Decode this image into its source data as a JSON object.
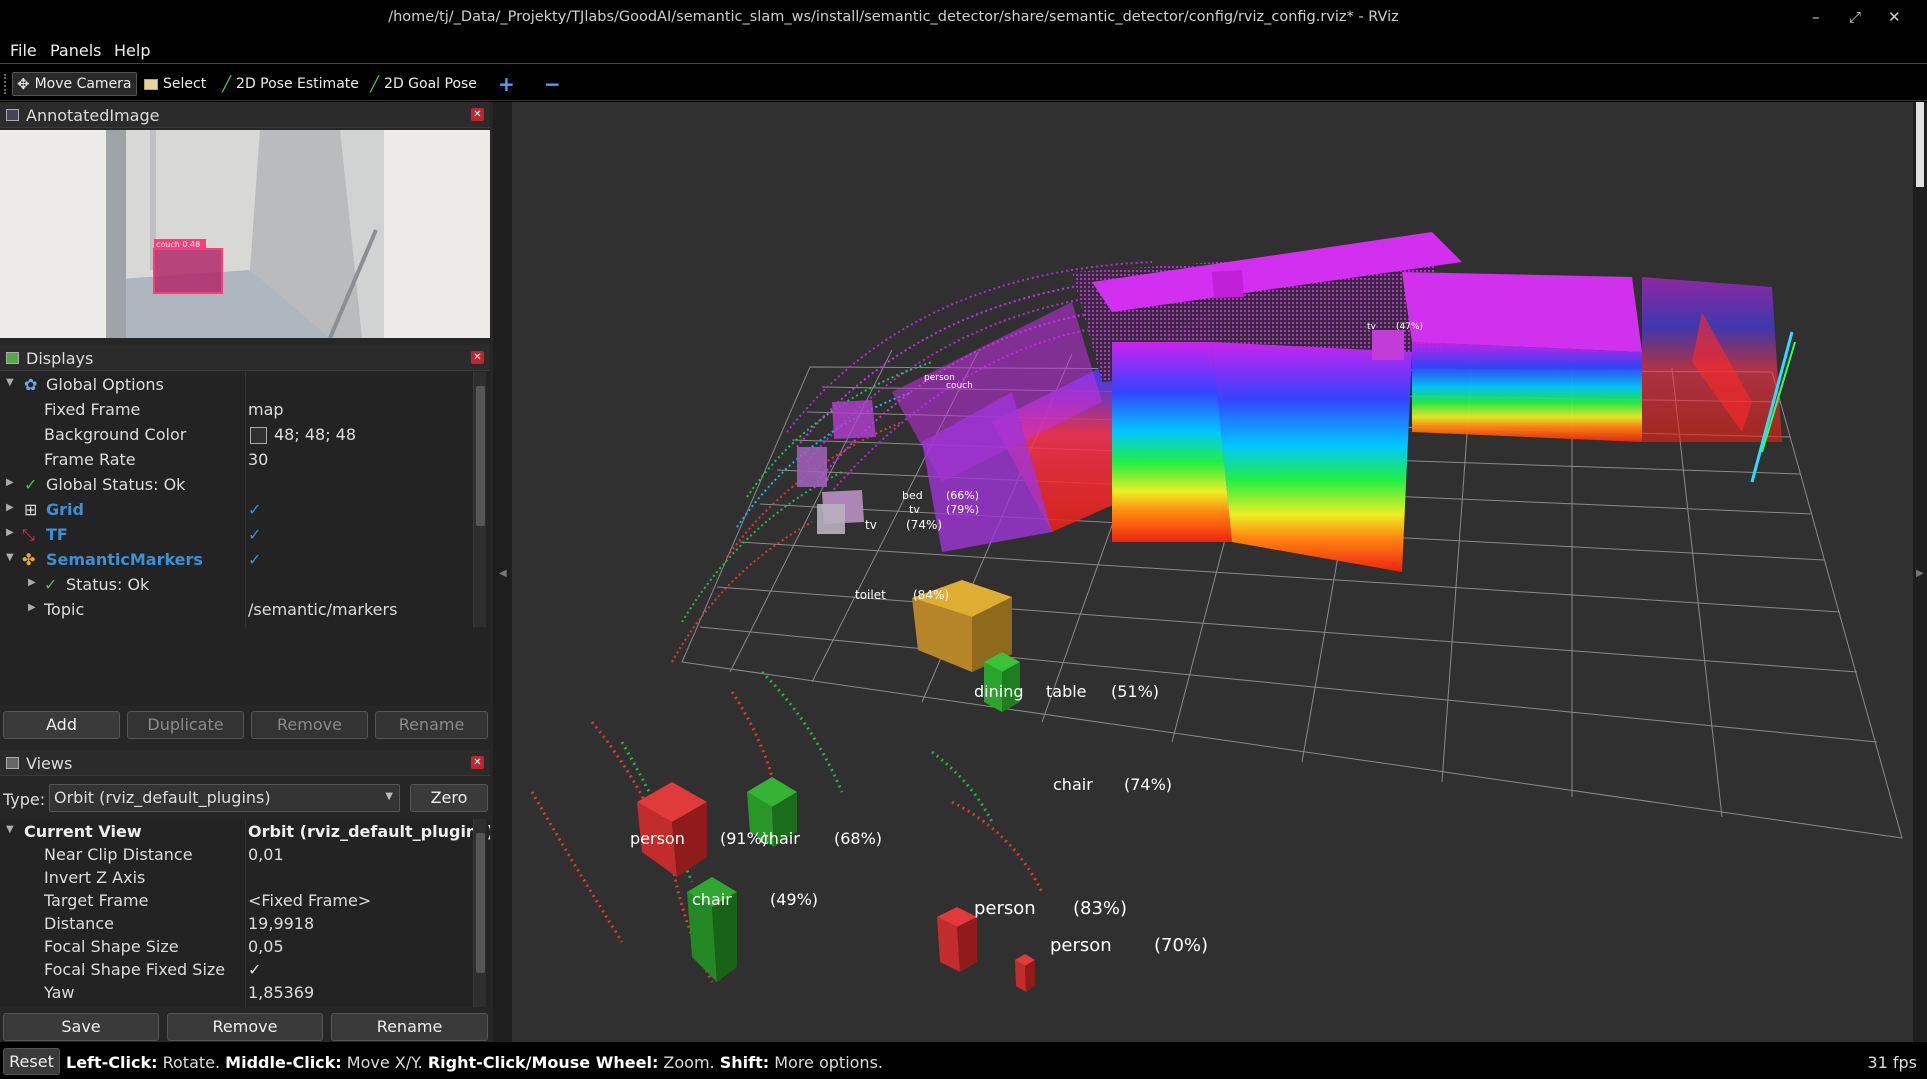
{
  "window": {
    "title": "/home/tj/_Data/_Projekty/TJlabs/GoodAI/semantic_slam_ws/install/semantic_detector/share/semantic_detector/config/rviz_config.rviz* - RViz",
    "minimize": "–",
    "maximize": "⤢",
    "close": "✕"
  },
  "menu": {
    "file": "File",
    "panels": "Panels",
    "help": "Help"
  },
  "toolbar": {
    "move_camera": "Move Camera",
    "select": "Select",
    "pose_estimate": "2D Pose Estimate",
    "goal_pose": "2D Goal Pose",
    "add": "+",
    "remove": "−"
  },
  "annotated_image": {
    "title": "AnnotatedImage",
    "detection_label": "couch 0.48"
  },
  "displays": {
    "title": "Displays",
    "global_options": "Global Options",
    "fixed_frame_k": "Fixed Frame",
    "fixed_frame_v": "map",
    "bg_color_k": "Background Color",
    "bg_color_v": "48; 48; 48",
    "frame_rate_k": "Frame Rate",
    "frame_rate_v": "30",
    "global_status": "Global Status: Ok",
    "grid": "Grid",
    "tf": "TF",
    "semantic_markers": "SemanticMarkers",
    "status_ok": "Status: Ok",
    "topic_k": "Topic",
    "topic_v": "/semantic/markers",
    "check": "✓",
    "buttons": {
      "add": "Add",
      "duplicate": "Duplicate",
      "remove": "Remove",
      "rename": "Rename"
    }
  },
  "views": {
    "title": "Views",
    "type_label": "Type:",
    "type_value": "Orbit (rviz_default_plugins)",
    "zero": "Zero",
    "current_view_k": "Current View",
    "current_view_v": "Orbit (rviz_default_plugins)",
    "props": [
      {
        "k": "Near Clip Distance",
        "v": "0,01"
      },
      {
        "k": "Invert Z Axis",
        "v": ""
      },
      {
        "k": "Target Frame",
        "v": "<Fixed Frame>"
      },
      {
        "k": "Distance",
        "v": "19,9918"
      },
      {
        "k": "Focal Shape Size",
        "v": "0,05"
      },
      {
        "k": "Focal Shape Fixed Size",
        "v": "✓"
      },
      {
        "k": "Yaw",
        "v": "1,85369"
      }
    ],
    "buttons": {
      "save": "Save",
      "remove": "Remove",
      "rename": "Rename"
    }
  },
  "scene_labels": [
    {
      "name": "dining",
      "text": "dining"
    },
    {
      "name": "table",
      "text": "table"
    },
    {
      "name": "table-pct",
      "text": "(51%)"
    },
    {
      "name": "chair1",
      "text": "chair"
    },
    {
      "name": "chair1-pct",
      "text": "(74%)"
    },
    {
      "name": "person1",
      "text": "person"
    },
    {
      "name": "person1-pct",
      "text": "(91%)"
    },
    {
      "name": "chair2",
      "text": "chair"
    },
    {
      "name": "chair2-pct",
      "text": "(68%)"
    },
    {
      "name": "chair3",
      "text": "chair"
    },
    {
      "name": "chair3-pct",
      "text": "(49%)"
    },
    {
      "name": "person2",
      "text": "person"
    },
    {
      "name": "person2-pct",
      "text": "(83%)"
    },
    {
      "name": "person3",
      "text": "person"
    },
    {
      "name": "person3-pct",
      "text": "(70%)"
    },
    {
      "name": "toilet",
      "text": "toilet"
    },
    {
      "name": "toilet-pct",
      "text": "(84%)"
    },
    {
      "name": "bed",
      "text": "bed"
    },
    {
      "name": "bed-pct",
      "text": "(66%)"
    },
    {
      "name": "tv1",
      "text": "tv"
    },
    {
      "name": "tv1-pct",
      "text": "(79%)"
    },
    {
      "name": "tv2",
      "text": "tv"
    },
    {
      "name": "tv2-pct",
      "text": "(74%)"
    },
    {
      "name": "tv3",
      "text": "tv"
    },
    {
      "name": "tv3-pct",
      "text": "(47%)"
    },
    {
      "name": "person4",
      "text": "person"
    },
    {
      "name": "couch",
      "text": "couch"
    }
  ],
  "status": {
    "reset": "Reset",
    "left_click": "Left-Click:",
    "left_click_desc": " Rotate. ",
    "middle_click": "Middle-Click:",
    "middle_click_desc": " Move X/Y. ",
    "right_click": "Right-Click/Mouse Wheel:",
    "right_click_desc": " Zoom. ",
    "shift": "Shift:",
    "shift_desc": " More options.",
    "fps": "31 fps"
  },
  "colors": {
    "accent": "#3d8fd6",
    "viewport_bg": "#303030",
    "close_red": "#c0262d"
  }
}
